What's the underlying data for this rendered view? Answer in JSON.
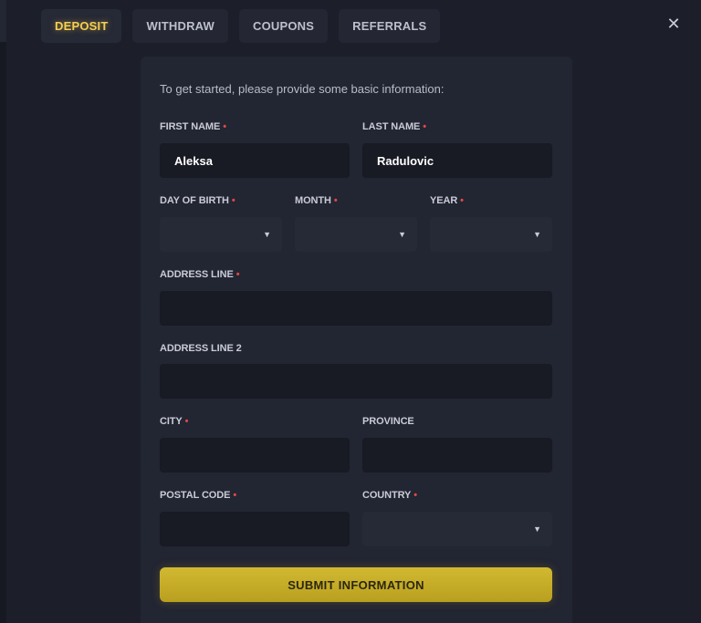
{
  "tabs": [
    {
      "label": "DEPOSIT",
      "active": true
    },
    {
      "label": "WITHDRAW",
      "active": false
    },
    {
      "label": "COUPONS",
      "active": false
    },
    {
      "label": "REFERRALS",
      "active": false
    }
  ],
  "close_glyph": "✕",
  "form": {
    "intro": "To get started, please provide some basic information:",
    "required_marker": "•",
    "first_name": {
      "label": "FIRST NAME",
      "value": "Aleksa"
    },
    "last_name": {
      "label": "LAST NAME",
      "value": "Radulovic"
    },
    "day": {
      "label": "DAY OF BIRTH",
      "value": ""
    },
    "month": {
      "label": "MONTH",
      "value": ""
    },
    "year": {
      "label": "YEAR",
      "value": ""
    },
    "address_line": {
      "label": "ADDRESS LINE",
      "value": ""
    },
    "address_line2": {
      "label": "ADDRESS LINE 2",
      "value": ""
    },
    "city": {
      "label": "CITY",
      "value": ""
    },
    "province": {
      "label": "PROVINCE",
      "value": ""
    },
    "postal_code": {
      "label": "POSTAL CODE",
      "value": ""
    },
    "country": {
      "label": "COUNTRY",
      "value": ""
    },
    "submit_label": "SUBMIT INFORMATION"
  },
  "caret_glyph": "▼",
  "colors": {
    "accent": "#f5cf52",
    "button": "#c9b02a",
    "required": "#e24848",
    "background": "#1c1f2a",
    "panel": "#222532"
  }
}
